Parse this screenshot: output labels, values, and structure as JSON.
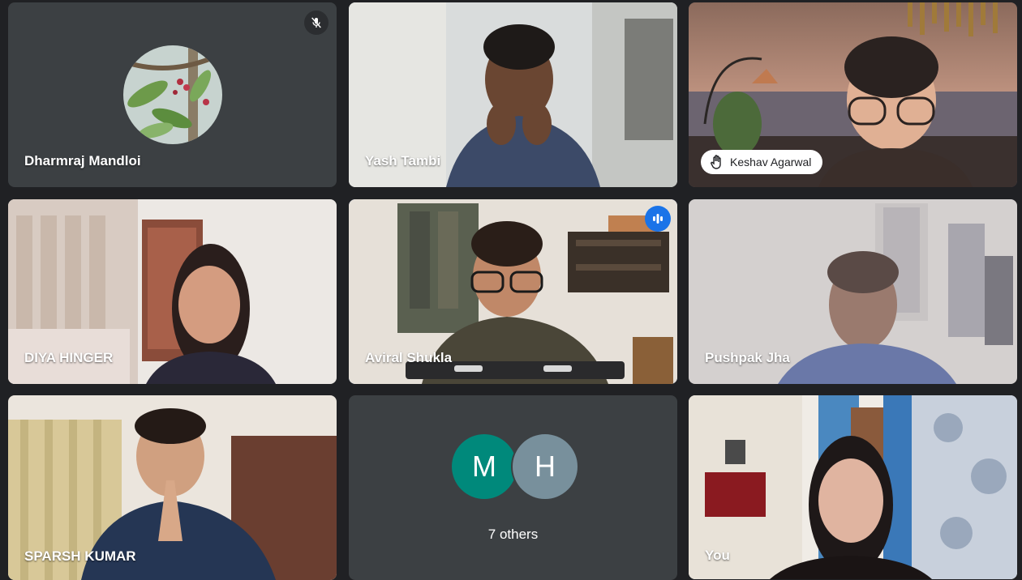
{
  "tiles": [
    {
      "name": "Dharmraj Mandloi",
      "muted": true
    },
    {
      "name": "Yash Tambi"
    },
    {
      "name": "Keshav Agarwal",
      "hand_raised": true
    },
    {
      "name": "DIYA HINGER"
    },
    {
      "name": "Aviral Shukla",
      "speaking": true
    },
    {
      "name": "Pushpak Jha"
    },
    {
      "name": "SPARSH KUMAR"
    },
    {
      "others": {
        "initials": [
          "M",
          "H"
        ],
        "label": "7 others"
      }
    },
    {
      "name": "You"
    }
  ],
  "colors": {
    "background": "#202124",
    "tile": "#3c4043",
    "speaking_border": "#8ab4f8",
    "speaking_badge": "#1a73e8",
    "avatar_m": "#00897b",
    "avatar_h": "#78909c"
  },
  "icons": {
    "muted": "mic-off-icon",
    "speaking": "audio-level-icon",
    "hand": "raised-hand-icon"
  }
}
